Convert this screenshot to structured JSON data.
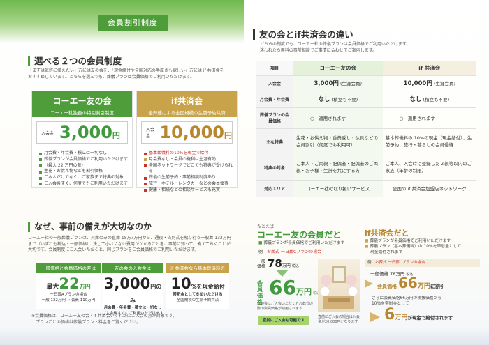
{
  "header": {
    "title": "会員割引制度"
  },
  "select": {
    "title": "選べる２つの会員制度",
    "desc1": "「まずは気軽に備えたい」方には友の会を、「現金給付や全国対応の手厚さも欲しい」方には if 共済会を",
    "desc2": "おすすめしています。どちらを選んでも、葬儀プランは会員価格でご利用いただけます。"
  },
  "tomo": {
    "name": "コーエー友の会",
    "sub": "コーエー社独自の特別割引制度",
    "fee_label": "入会金",
    "fee": "3,000",
    "yen": "円",
    "features": [
      "月会費・年会費・積立は一切なし",
      "葬儀プランが会員価格でご利用いただけます",
      "（最大 22 万円の差）",
      "生花・お供え物なども割引価格",
      "ご本人だけでなく、ご家族まで特典の対象",
      "ご入会後すぐ、何度でもご利用いただけます"
    ]
  },
  "ifk": {
    "name": "if共済会",
    "sub": "全葬連による全国規模の生前予約共済",
    "fee_label": "入会金",
    "fee": "10,000",
    "yen": "円",
    "features": [
      "基本葬儀料の10%を現金で給付",
      "月会費なし・会員の権利は生涯有効",
      "全国ネットワークでどこでも特典が受けられる",
      "葬儀の生前予約・事前相談制度あり",
      "旅行・ホテル・レンタカーなどの会員優待",
      "健康・相続などの相談サービスも充実"
    ]
  },
  "diff": {
    "title": "友の会とif共済会の違い",
    "desc1": "どちらの制度でも、コーエー社の葬儀プランは会員価格でご利用いただけます。",
    "desc2": "迷われたら無料の事前相談でご事情に合わせてご案内します。",
    "col_item": "項目",
    "col_tomo": "コーエー友の会",
    "col_if": "if 共済会",
    "rows": [
      {
        "label": "入会金",
        "tomo": "3,000円",
        "tomo_note": "(生涯会員)",
        "ifk": "10,000円",
        "ifk_note": "(生涯会員)"
      },
      {
        "label": "月会費・年会費",
        "tomo": "なし",
        "tomo_note": "(積立も不要)",
        "ifk": "なし",
        "ifk_note": "(積立も不要)"
      },
      {
        "label": "葬儀プランの会員価格",
        "tomo": "適用されます",
        "tomo_note": "",
        "ifk": "適用されます",
        "ifk_note": ""
      },
      {
        "label": "主な特典",
        "tomo": "生花・お供え物・香典返し・仏具などの会員割引（何度でも利用可）",
        "tomo_note": "",
        "ifk": "基本葬儀料の 10%の現金（現金給付）、生前予約、旅行・暮らしの会員優待",
        "ifk_note": ""
      },
      {
        "label": "特典の対象",
        "tomo": "ご本人・ご両親・配偶者・配偶者のご両親・お子様・生計を共にする方",
        "tomo_note": "",
        "ifk": "ご本人、入会時に登録した２親等以内のご家族（年齢の制限）",
        "ifk_note": ""
      },
      {
        "label": "対応エリア",
        "tomo": "コーエー社の取り扱いサービス",
        "tomo_note": "",
        "ifk": "全国の if 共済会加盟店ネットワーク",
        "ifk_note": ""
      }
    ]
  },
  "why": {
    "title": "なぜ、事前の備えが大切なのか",
    "desc": [
      "コーエー社の一般葬儀プランは、火葬のみの直葬 18万7万円から、通夜・告別式を執り行う一般葬 132万円",
      "まで（いずれも税込・一般価格）、決して小さくない費用がかかることを、事前に知って、備えておくことが",
      "大切です。会員制度にご入会いただくと、同じプランをご会員価格でご利用いただけます。"
    ],
    "box1_label": "一般価格と会員価格の差は",
    "box1_pre": "最大",
    "box1_num": "22",
    "box1_unit": "万円",
    "box1_note1": "一日葬Aプランの場合",
    "box1_note2": "一般 132万円 → 会員 110万円",
    "box2_label": "友の会の入会金は",
    "box2_num": "3,000",
    "box2_unit": "円のみ",
    "box2_note1": "月会費・年会費・積立は一切なし",
    "box2_note2": "ご入会後すぐにご利用いただけます",
    "box3_label": "if 共済会なら基本葬儀料の",
    "box3_num": "10",
    "box3_unit": "%を現金給付",
    "box3_note1": "帯祀金として支払いただける",
    "box3_note2": "全国規模の生前予約共済",
    "footnote1": "※会員価格は、コーエー友の会・if 共済会いずれかにご入会の方が対象です。",
    "footnote2": "　プランごとの価格は葬儀プラン・料金をご覧ください。"
  },
  "example": {
    "lead": "たとえば",
    "tomo_title": "コーエー友の会員だと",
    "tomo_sub": "葬儀プランが会員価格でご利用いただけます",
    "case_tag": "例",
    "case": "お葬式 一日葬Cプランの場合",
    "general_label": "一般価格",
    "general_price": "78",
    "general_unit": "万円",
    "tax": "税込",
    "member_label": "会員価格",
    "member_price": "66",
    "member_unit": "万円",
    "member_tax": "税込",
    "note": "友の会にご入会いただくとお葬式の際の会員価格が適用されます",
    "tag": "直前にご入会も可能です",
    "photo_caption": "直前にご入会の場合は入会金が20,000円となります",
    "if_title": "if共済会だと",
    "if_b1": "葬儀プランが会員価格でご利用いただけます",
    "if_b2": "葬儀プラン（基本葬儀料）の 10％を帯慰金として",
    "if_b2b": "現金給付されます",
    "if_case": "お葬式 一日葬Cプランの場合",
    "if_line1": "一般価格 78万円",
    "if_line1_tax": "税込",
    "if_arrow_label": "会員価格",
    "if_member": "66",
    "if_member_unit": "万円",
    "if_member_suffix": "に割引",
    "if_desc1": "さらに会員価格66万円の税抜価格から",
    "if_desc2": "10％を帯慰金として",
    "if_cash": "6",
    "if_cash_unit": "万円",
    "if_cash_suffix": "が現金で給付されます"
  }
}
